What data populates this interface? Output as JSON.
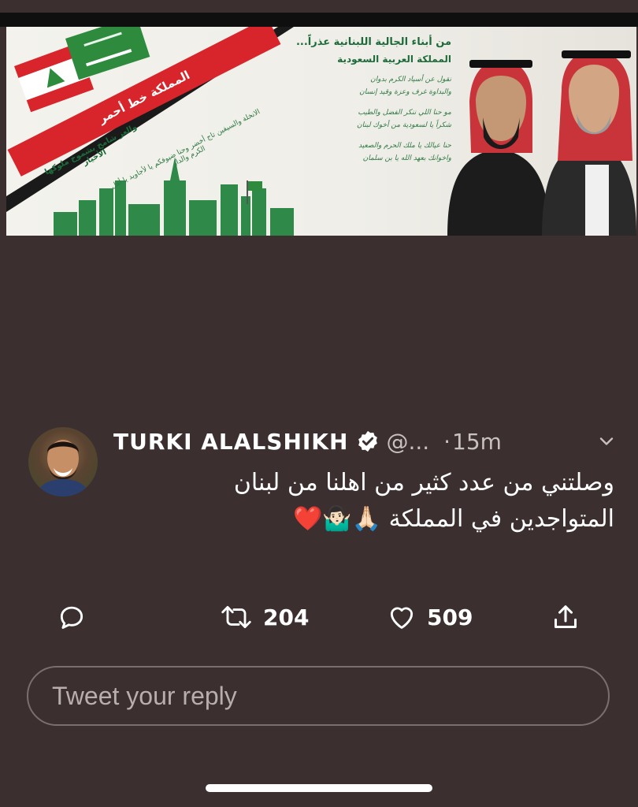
{
  "poster": {
    "heading_line1": "من أبناء الجالية اللبنانية  عذراً...",
    "heading_line2": "المملكة العربية السعودية",
    "verse_lines": [
      "نقول عن أسياد الكرم بدوان",
      "والبداوة غرف وعزة وقيد إنسان",
      "مو حنا اللي ننكر الفضل والطيب",
      "شكراً يا لسعودية من أخوك لبنان",
      "حنا عيالك يا ملك الحرم والصعيد",
      "واخوانك بعهد الله يا بن سلمان"
    ],
    "banner_text": "المملكة خط أحمر",
    "left_text1": "والعز شامخ بشموخ ملوكها الأخيار",
    "left_text2": "الانخلة والسيفين تاج أخضر وحنا ضيوفكم يا لأجاويد يا أهل الكرم والدار"
  },
  "tweet": {
    "display_name": "TURKI ALALSHIKH",
    "handle": "@...",
    "separator": "·",
    "time": "15m",
    "text_line1": "وصلتني من عدد كثير من اهلنا من لبنان",
    "text_line2": "المتواجدين في المملكة 🙏🏻🤷🏻‍♂️❤️"
  },
  "actions": {
    "retweets": "204",
    "likes": "509"
  },
  "reply": {
    "placeholder": "Tweet your reply"
  },
  "colors": {
    "background": "#3b2f30",
    "text": "#ffffff",
    "secondary_text": "#c9c0c0",
    "saudi_green": "#1d6b3a",
    "lebanon_red": "#d8242b"
  },
  "icons": [
    "verified-icon",
    "chevron-down-icon",
    "reply-icon",
    "retweet-icon",
    "heart-icon",
    "share-icon"
  ]
}
